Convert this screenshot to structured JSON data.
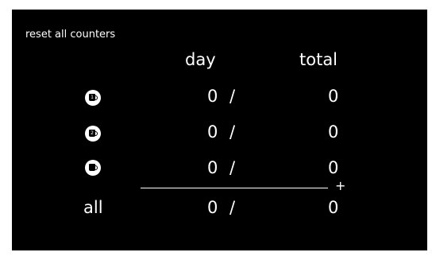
{
  "reset_label": "reset all counters",
  "headers": {
    "day": "day",
    "total": "total"
  },
  "rows": [
    {
      "icon": "coffee-cup-icon",
      "icon_text": "1",
      "day": "0",
      "sep": "/",
      "total": "0"
    },
    {
      "icon": "coffee-cup-icon",
      "icon_text": "2",
      "day": "0",
      "sep": "/",
      "total": "0"
    },
    {
      "icon": "coffee-cup-icon",
      "icon_text": "",
      "day": "0",
      "sep": "/",
      "total": "0"
    }
  ],
  "summary": {
    "label": "all",
    "day": "0",
    "sep": "/",
    "total": "0",
    "plus": "+"
  }
}
